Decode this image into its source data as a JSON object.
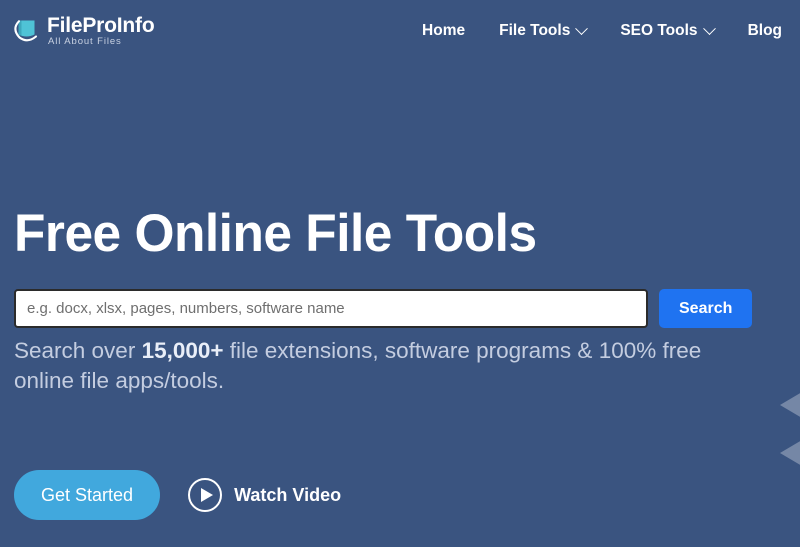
{
  "theme": {
    "background": "#3a5480",
    "primary_button": "#1f73f1",
    "cta_button": "#41a8dd",
    "logo_accent": "#4fc3d6",
    "heading_color": "#ffffff",
    "subtitle_color": "#c4cde0"
  },
  "header": {
    "brand": {
      "name": "FileProInfo",
      "tagline": "All About Files",
      "icon": "file-page-icon"
    },
    "nav": [
      {
        "label": "Home",
        "has_dropdown": false
      },
      {
        "label": "File Tools",
        "has_dropdown": true
      },
      {
        "label": "SEO Tools",
        "has_dropdown": true
      },
      {
        "label": "Blog",
        "has_dropdown": false
      }
    ]
  },
  "hero": {
    "title": "Free Online File Tools",
    "search": {
      "value": "",
      "placeholder": "e.g. docx, xlsx, pages, numbers, software name",
      "button_label": "Search"
    },
    "subtitle": {
      "part1": "Search over ",
      "highlight": "15,000+",
      "part2": " file extensions, software programs & 100% free online file apps/tools."
    },
    "cta": {
      "primary_label": "Get Started",
      "video_label": "Watch Video",
      "video_icon": "play-circle-icon"
    }
  },
  "decoration": {
    "right_arrows_count": 2,
    "arrow_icon": "chevron-left-triangle-icon"
  }
}
